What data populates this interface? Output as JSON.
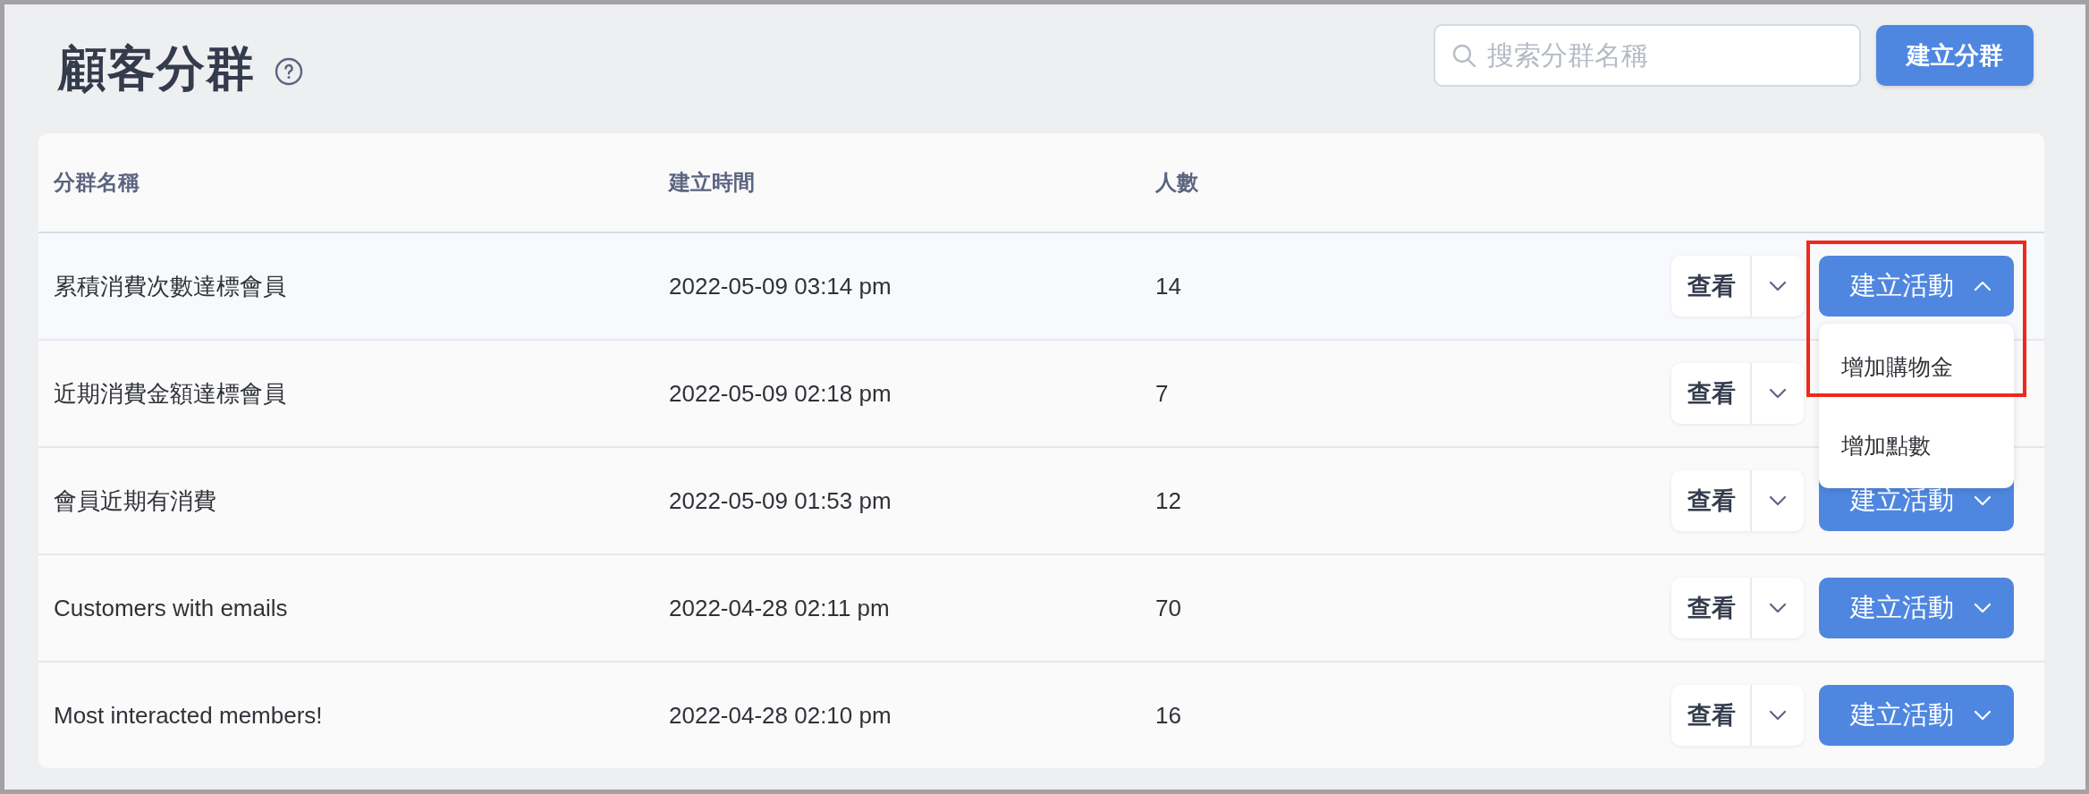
{
  "page": {
    "title": "顧客分群"
  },
  "search": {
    "placeholder": "搜索分群名稱"
  },
  "create_button": "建立分群",
  "table": {
    "columns": [
      "分群名稱",
      "建立時間",
      "人數"
    ],
    "rows": [
      {
        "name": "累積消費次數達標會員",
        "created": "2022-05-09 03:14 pm",
        "count": "14",
        "view": "查看",
        "action": "建立活動",
        "expanded": true,
        "annotated": true,
        "menu_items": [
          "增加購物金",
          "增加點數"
        ]
      },
      {
        "name": "近期消費金額達標會員",
        "created": "2022-05-09 02:18 pm",
        "count": "7",
        "view": "查看",
        "expanded": false,
        "annotated": false
      },
      {
        "name": "會員近期有消費",
        "created": "2022-05-09 01:53 pm",
        "count": "12",
        "view": "查看",
        "action": "建立活動",
        "expanded": false,
        "annotated": false
      },
      {
        "name": "Customers with emails",
        "created": "2022-04-28 02:11 pm",
        "count": "70",
        "view": "查看",
        "action": "建立活動",
        "expanded": false,
        "annotated": false
      },
      {
        "name": "Most interacted members!",
        "created": "2022-04-28 02:10 pm",
        "count": "16",
        "view": "查看",
        "action": "建立活動",
        "expanded": false,
        "annotated": false
      }
    ]
  }
}
